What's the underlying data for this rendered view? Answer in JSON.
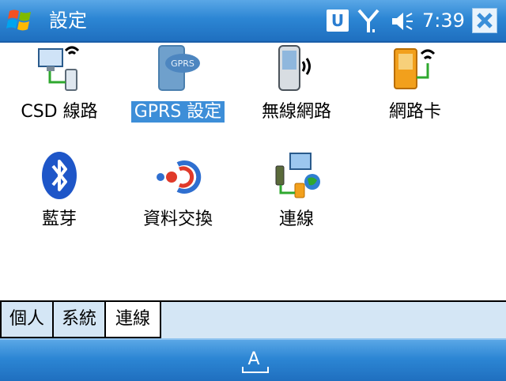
{
  "title_bar": {
    "title": "設定",
    "clock": "7:39",
    "u_indicator": "U",
    "icons": [
      "windows-start-icon",
      "signal-icon",
      "volume-icon",
      "close-icon"
    ]
  },
  "items": [
    {
      "label": "CSD 線路",
      "icon": "csd-line-icon",
      "selected": false
    },
    {
      "label": "GPRS 設定",
      "icon": "gprs-icon",
      "selected": true
    },
    {
      "label": "無線網路",
      "icon": "wireless-network-icon",
      "selected": false
    },
    {
      "label": "網路卡",
      "icon": "network-card-icon",
      "selected": false
    },
    {
      "label": "藍芽",
      "icon": "bluetooth-icon",
      "selected": false
    },
    {
      "label": "資料交換",
      "icon": "beam-icon",
      "selected": false
    },
    {
      "label": "連線",
      "icon": "connections-icon",
      "selected": false
    }
  ],
  "tabs": [
    {
      "label": "個人",
      "active": false
    },
    {
      "label": "系統",
      "active": false
    },
    {
      "label": "連線",
      "active": true
    }
  ],
  "bottom_bar": {
    "input_label": "A",
    "icon": "keyboard-input-icon"
  },
  "colors": {
    "bar": "#2c86d4",
    "selection": "#3d8ed8",
    "tab_bg": "#d4e6f5"
  }
}
